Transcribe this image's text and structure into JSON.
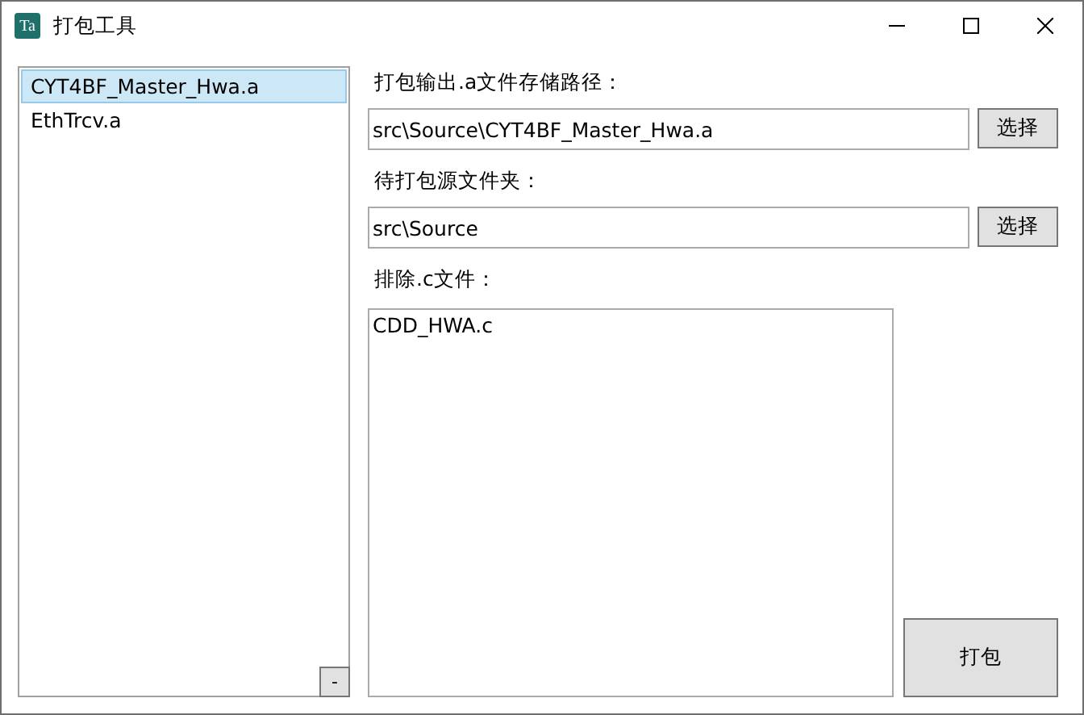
{
  "window": {
    "icon_text": "Ta",
    "title": "打包工具"
  },
  "file_list": {
    "items": [
      {
        "label": "CYT4BF_Master_Hwa.a",
        "selected": true
      },
      {
        "label": "EthTrcv.a",
        "selected": false
      }
    ],
    "remove_button": "-"
  },
  "output_path": {
    "label": "打包输出.a文件存储路径：",
    "value": "src\\Source\\CYT4BF_Master_Hwa.a",
    "button": "选择"
  },
  "source_folder": {
    "label": "待打包源文件夹：",
    "value": "src\\Source",
    "button": "选择"
  },
  "exclude": {
    "label": "排除.c文件：",
    "value": "CDD_HWA.c"
  },
  "pack_button": "打包"
}
